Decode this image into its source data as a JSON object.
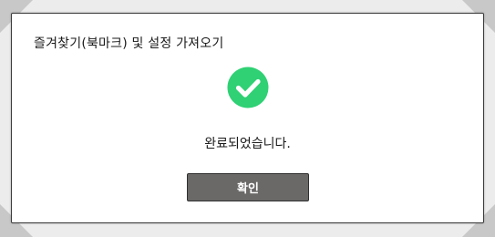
{
  "dialog": {
    "title": "즐겨찾기(북마크) 및 설정 가져오기",
    "message": "완료되었습니다.",
    "confirm_label": "확인"
  },
  "icons": {
    "status": "check-circle-icon"
  },
  "colors": {
    "success": "#2fd174",
    "button_bg": "#6b6968",
    "button_text": "#ffffff",
    "corner": "#c8c8c8"
  }
}
